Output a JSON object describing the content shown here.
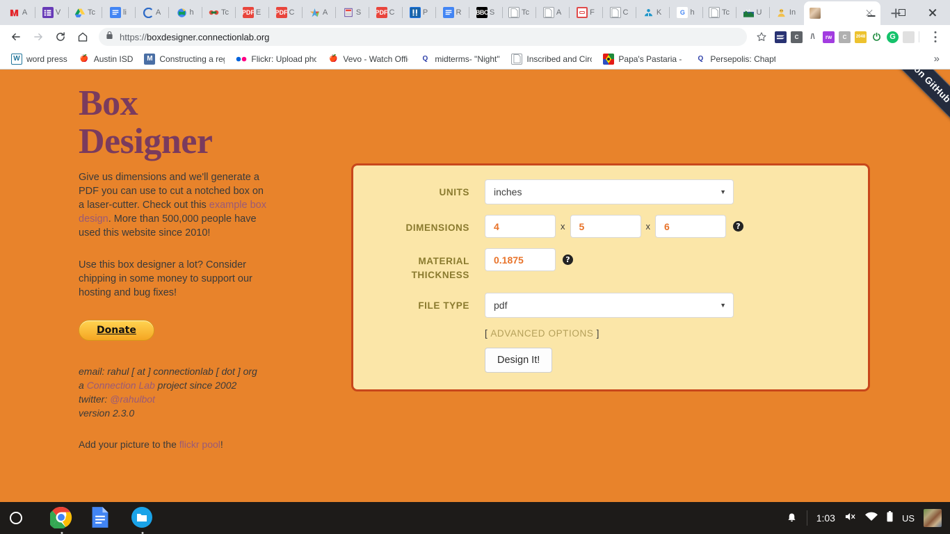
{
  "browser": {
    "pinned_tabs": [
      {
        "icon": "mcgraw-hill-icon",
        "title": "A"
      },
      {
        "icon": "list-purple-icon",
        "title": "V"
      },
      {
        "icon": "google-drive-icon",
        "title": "Tc"
      },
      {
        "icon": "google-docs-icon",
        "title": "li"
      },
      {
        "icon": "canvas-icon",
        "title": "A"
      },
      {
        "icon": "google-earth-icon",
        "title": "h"
      },
      {
        "icon": "clever-icon",
        "title": "Tc"
      },
      {
        "icon": "pdf-icon",
        "title": "E"
      },
      {
        "icon": "pdf-icon",
        "title": "C"
      },
      {
        "icon": "star-icon",
        "title": "A"
      },
      {
        "icon": "calculator-icon",
        "title": "S"
      },
      {
        "icon": "pdf-icon",
        "title": "C"
      },
      {
        "icon": "blue-square-icon",
        "title": "P"
      },
      {
        "icon": "google-docs-icon",
        "title": "R"
      },
      {
        "icon": "bbc-icon",
        "title": "S"
      },
      {
        "icon": "page-icon",
        "title": "Tc"
      },
      {
        "icon": "page-icon",
        "title": "A"
      },
      {
        "icon": "stop-sign-icon",
        "title": "F"
      },
      {
        "icon": "page-icon",
        "title": "C"
      },
      {
        "icon": "people-icon",
        "title": "K"
      },
      {
        "icon": "google-icon",
        "title": "h"
      },
      {
        "icon": "page-icon",
        "title": "Tc"
      },
      {
        "icon": "mountain-icon",
        "title": "U"
      },
      {
        "icon": "person-icon",
        "title": "In"
      }
    ],
    "active_tab": {
      "title": "",
      "favicon": "photo-icon"
    },
    "new_tab_label": "+",
    "window_controls": {
      "minimize": "minimize-button",
      "maximize": "maximize-button",
      "close": "close-button"
    },
    "omnibox": {
      "scheme": "https://",
      "host": "boxdesigner.connectionlab.org",
      "lock": "lock-icon",
      "star": "bookmark-star-icon"
    },
    "extensions": [
      {
        "name": "sumatra-ext",
        "label": "S",
        "color": "#283272"
      },
      {
        "name": "c-grey-ext",
        "label": "C",
        "color": "#5f6368"
      },
      {
        "name": "lambda-ext",
        "label": "/\\",
        "color": "#ffffff"
      },
      {
        "name": "rw-ext",
        "label": "rw",
        "color": "#a23ce0"
      },
      {
        "name": "c-light-ext",
        "label": "C",
        "color": "#b0b0b0"
      },
      {
        "name": "2048-ext",
        "label": "2048",
        "color": "#edc22e"
      },
      {
        "name": "power-ext",
        "label": "⏻",
        "color": "#1e8a3e"
      },
      {
        "name": "grammarly-ext",
        "label": "G",
        "color": "#15c26b"
      },
      {
        "name": "faded-ext",
        "label": "",
        "color": "#d4d4d4"
      }
    ],
    "bookmarks": [
      {
        "label": "word press",
        "icon": "wordpress-icon"
      },
      {
        "label": "Austin ISD",
        "icon": "apple-icon"
      },
      {
        "label": "Constructing a regula",
        "icon": "m-icon"
      },
      {
        "label": "Flickr: Upload photos",
        "icon": "flickr-icon"
      },
      {
        "label": "Vevo - Watch Official",
        "icon": "apple-icon"
      },
      {
        "label": "midterms- \"Night\" pg",
        "icon": "quizlet-icon"
      },
      {
        "label": "Inscribed and Circum",
        "icon": "document-icon"
      },
      {
        "label": "Papa's Pastaria - Pla",
        "icon": "papas-icon"
      },
      {
        "label": "Persepolis: Chapters",
        "icon": "quizlet-icon"
      }
    ],
    "bookmarks_overflow": "»"
  },
  "page": {
    "ribbon": "Fork me on GitHub",
    "title": "Box Designer",
    "blurb": {
      "part1": "Give us dimensions and we'll generate a PDF you can use to cut a notched box on a laser-cutter. Check out this ",
      "link": "example box design",
      "part2": ". More than 500,000 people have used this website since 2010!"
    },
    "support_text": "Use this box designer a lot? Consider chipping in some money to support our hosting and bug fixes!",
    "donate_label": "Donate",
    "meta": {
      "email_line": "email: rahul [ at ] connectionlab [ dot ] org",
      "project_prefix": "a ",
      "project_link": "Connection Lab",
      "project_suffix": " project since 2002",
      "twitter_prefix": "twitter: ",
      "twitter_link": "@rahulbot",
      "version": "version 2.3.0"
    },
    "flickr": {
      "prefix": "Add your picture to the ",
      "link": "flickr pool",
      "suffix": "!"
    }
  },
  "form": {
    "units": {
      "label": "UNITS",
      "value": "inches",
      "caret": "▼"
    },
    "dimensions": {
      "label": "DIMENSIONS",
      "width": "4",
      "height": "5",
      "depth": "6",
      "separator": "x",
      "help": "?"
    },
    "material_thickness": {
      "label_line1": "MATERIAL",
      "label_line2": "THICKNESS",
      "value": "0.1875",
      "help": "?"
    },
    "file_type": {
      "label": "FILE TYPE",
      "value": "pdf",
      "caret": "▼"
    },
    "advanced": {
      "open": "[",
      "link": "ADVANCED OPTIONS",
      "close": "]"
    },
    "submit_label": "Design It!"
  },
  "shelf": {
    "launcher": "launcher-button",
    "apps": [
      {
        "name": "chrome-app",
        "active": true
      },
      {
        "name": "google-docs-app",
        "active": false
      },
      {
        "name": "files-app",
        "active": true
      }
    ],
    "status": {
      "notification": "bell-icon",
      "time": "1:03",
      "volume": "volume-muted-icon",
      "wifi": "wifi-icon",
      "battery": "battery-icon",
      "locale": "US",
      "avatar": "user-avatar"
    }
  },
  "colors": {
    "page_bg": "#e8832b",
    "panel_bg": "#fbe6a8",
    "panel_border": "#c8471b",
    "title": "#7a3b5e",
    "label": "#8a7a2e",
    "input_value": "#e8732a",
    "link": "#9a5a77",
    "ribbon": "#242b3d"
  }
}
